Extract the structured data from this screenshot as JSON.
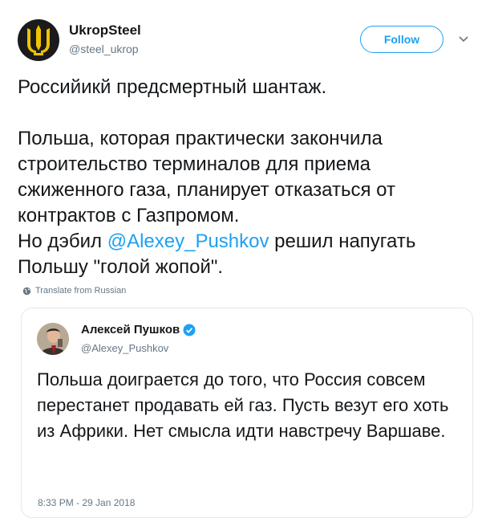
{
  "author": {
    "name": "UkropSteel",
    "handle": "@steel_ukrop"
  },
  "follow_label": "Follow",
  "tweet": {
    "line1": "Российикй предсмертный шантаж.",
    "line2": "Польша, которая практически закончила строительство терминалов для приема сжиженного газа, планирует отказаться от контрактов с Газпромом.",
    "line3_before": "Но дэбил ",
    "mention": "@Alexey_Pushkov",
    "line3_after": " решил напугать Польшу \"голой жопой\"."
  },
  "translate_label": "Translate from Russian",
  "quoted": {
    "name": "Алексей Пушков",
    "handle": "@Alexey_Pushkov",
    "text": "Польша доиграется до того, что Россия совсем перестанет продавать ей газ. Пусть везут его хоть из Африки. Нет смысла идти навстречу Варшаве.",
    "timestamp": "8:33 PM - 29 Jan 2018"
  },
  "colors": {
    "accent": "#1da1f2",
    "muted": "#657786",
    "text": "#14171a",
    "border": "#e1e8ed"
  }
}
